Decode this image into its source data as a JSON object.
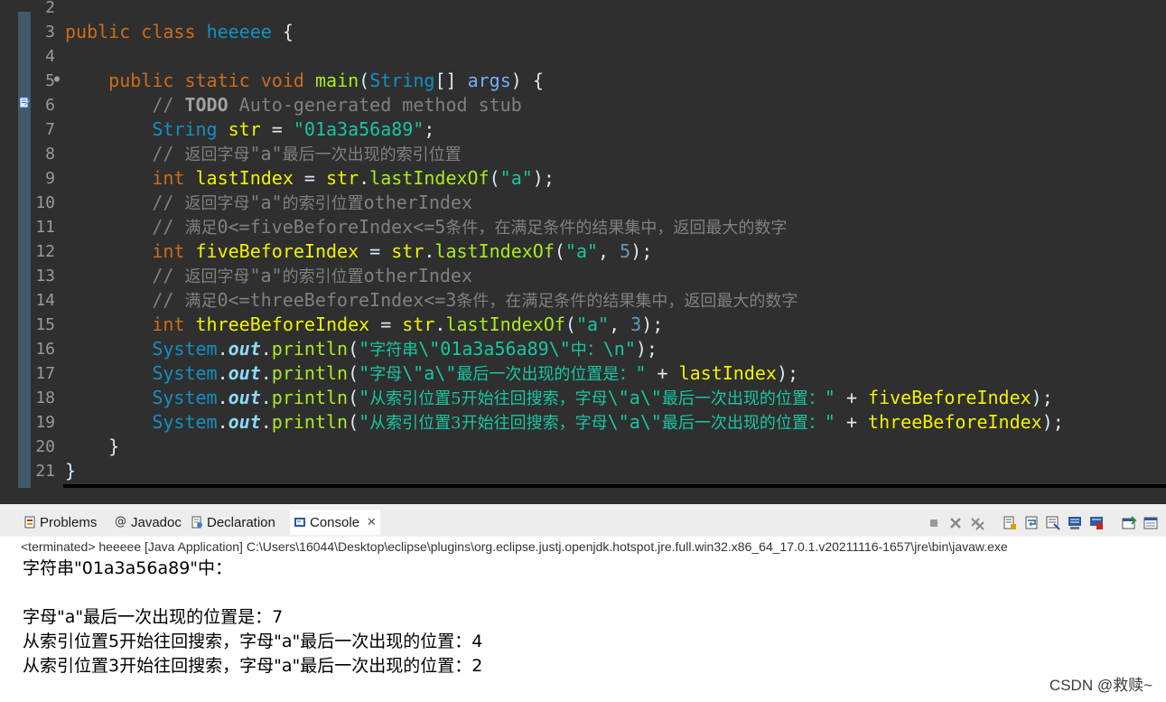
{
  "editor": {
    "lines": [
      {
        "n": "2",
        "tokens": []
      },
      {
        "n": "3",
        "tokens": [
          {
            "c": "t-kw",
            "t": "public"
          },
          {
            "c": "t-plain",
            "t": " "
          },
          {
            "c": "t-kw",
            "t": "class"
          },
          {
            "c": "t-plain",
            "t": " "
          },
          {
            "c": "t-cls",
            "t": "heeeee"
          },
          {
            "c": "t-plain",
            "t": " {"
          }
        ]
      },
      {
        "n": "4",
        "tokens": []
      },
      {
        "n": "5",
        "fold": true,
        "tokens": [
          {
            "c": "t-plain",
            "t": "    "
          },
          {
            "c": "t-kw",
            "t": "public"
          },
          {
            "c": "t-plain",
            "t": " "
          },
          {
            "c": "t-kw",
            "t": "static"
          },
          {
            "c": "t-plain",
            "t": " "
          },
          {
            "c": "t-kw",
            "t": "void"
          },
          {
            "c": "t-plain",
            "t": " "
          },
          {
            "c": "t-meth",
            "t": "main"
          },
          {
            "c": "t-plain",
            "t": "("
          },
          {
            "c": "t-cls",
            "t": "String"
          },
          {
            "c": "t-plain",
            "t": "[] "
          },
          {
            "c": "t-par",
            "t": "args"
          },
          {
            "c": "t-plain",
            "t": ") {"
          }
        ]
      },
      {
        "n": "6",
        "tokens": [
          {
            "c": "t-plain",
            "t": "        "
          },
          {
            "c": "t-cmt",
            "t": "// "
          },
          {
            "c": "t-todo",
            "t": "TODO"
          },
          {
            "c": "t-cmt",
            "t": " Auto-generated method stub"
          }
        ]
      },
      {
        "n": "7",
        "tokens": [
          {
            "c": "t-plain",
            "t": "        "
          },
          {
            "c": "t-cls",
            "t": "String"
          },
          {
            "c": "t-plain",
            "t": " "
          },
          {
            "c": "t-var",
            "t": "str"
          },
          {
            "c": "t-plain",
            "t": " = "
          },
          {
            "c": "t-str",
            "t": "\"01a3a56a89\""
          },
          {
            "c": "t-plain",
            "t": ";"
          }
        ]
      },
      {
        "n": "8",
        "tokens": [
          {
            "c": "t-plain",
            "t": "        "
          },
          {
            "c": "t-cmt",
            "t": "// "
          },
          {
            "c": "t-cmt zh",
            "t": "返回字母"
          },
          {
            "c": "t-cmt",
            "t": "\"a\""
          },
          {
            "c": "t-cmt zh",
            "t": "最后一次出现的索引位置"
          }
        ]
      },
      {
        "n": "9",
        "tokens": [
          {
            "c": "t-plain",
            "t": "        "
          },
          {
            "c": "t-kw",
            "t": "int"
          },
          {
            "c": "t-plain",
            "t": " "
          },
          {
            "c": "t-var",
            "t": "lastIndex"
          },
          {
            "c": "t-plain",
            "t": " = "
          },
          {
            "c": "t-var",
            "t": "str"
          },
          {
            "c": "t-plain",
            "t": "."
          },
          {
            "c": "t-meth",
            "t": "lastIndexOf"
          },
          {
            "c": "t-plain",
            "t": "("
          },
          {
            "c": "t-str",
            "t": "\"a\""
          },
          {
            "c": "t-plain",
            "t": ");"
          }
        ]
      },
      {
        "n": "10",
        "tokens": [
          {
            "c": "t-plain",
            "t": "        "
          },
          {
            "c": "t-cmt",
            "t": "// "
          },
          {
            "c": "t-cmt zh",
            "t": "返回字母"
          },
          {
            "c": "t-cmt",
            "t": "\"a\""
          },
          {
            "c": "t-cmt zh",
            "t": "的索引位置"
          },
          {
            "c": "t-cmt",
            "t": "otherIndex"
          }
        ]
      },
      {
        "n": "11",
        "tokens": [
          {
            "c": "t-plain",
            "t": "        "
          },
          {
            "c": "t-cmt",
            "t": "// "
          },
          {
            "c": "t-cmt zh",
            "t": "满足"
          },
          {
            "c": "t-cmt",
            "t": "0<=fiveBeforeIndex<=5"
          },
          {
            "c": "t-cmt zh",
            "t": "条件，在满足条件的结果集中，返回最大的数字"
          }
        ]
      },
      {
        "n": "12",
        "tokens": [
          {
            "c": "t-plain",
            "t": "        "
          },
          {
            "c": "t-kw",
            "t": "int"
          },
          {
            "c": "t-plain",
            "t": " "
          },
          {
            "c": "t-var",
            "t": "fiveBeforeIndex"
          },
          {
            "c": "t-plain",
            "t": " = "
          },
          {
            "c": "t-var",
            "t": "str"
          },
          {
            "c": "t-plain",
            "t": "."
          },
          {
            "c": "t-meth",
            "t": "lastIndexOf"
          },
          {
            "c": "t-plain",
            "t": "("
          },
          {
            "c": "t-str",
            "t": "\"a\""
          },
          {
            "c": "t-plain",
            "t": ", "
          },
          {
            "c": "t-num",
            "t": "5"
          },
          {
            "c": "t-plain",
            "t": ");"
          }
        ]
      },
      {
        "n": "13",
        "tokens": [
          {
            "c": "t-plain",
            "t": "        "
          },
          {
            "c": "t-cmt",
            "t": "// "
          },
          {
            "c": "t-cmt zh",
            "t": "返回字母"
          },
          {
            "c": "t-cmt",
            "t": "\"a\""
          },
          {
            "c": "t-cmt zh",
            "t": "的索引位置"
          },
          {
            "c": "t-cmt",
            "t": "otherIndex"
          }
        ]
      },
      {
        "n": "14",
        "tokens": [
          {
            "c": "t-plain",
            "t": "        "
          },
          {
            "c": "t-cmt",
            "t": "// "
          },
          {
            "c": "t-cmt zh",
            "t": "满足"
          },
          {
            "c": "t-cmt",
            "t": "0<=threeBeforeIndex<=3"
          },
          {
            "c": "t-cmt zh",
            "t": "条件，在满足条件的结果集中，返回最大的数字"
          }
        ]
      },
      {
        "n": "15",
        "tokens": [
          {
            "c": "t-plain",
            "t": "        "
          },
          {
            "c": "t-kw",
            "t": "int"
          },
          {
            "c": "t-plain",
            "t": " "
          },
          {
            "c": "t-var",
            "t": "threeBeforeIndex"
          },
          {
            "c": "t-plain",
            "t": " = "
          },
          {
            "c": "t-var",
            "t": "str"
          },
          {
            "c": "t-plain",
            "t": "."
          },
          {
            "c": "t-meth",
            "t": "lastIndexOf"
          },
          {
            "c": "t-plain",
            "t": "("
          },
          {
            "c": "t-str",
            "t": "\"a\""
          },
          {
            "c": "t-plain",
            "t": ", "
          },
          {
            "c": "t-num",
            "t": "3"
          },
          {
            "c": "t-plain",
            "t": ");"
          }
        ]
      },
      {
        "n": "16",
        "tokens": [
          {
            "c": "t-plain",
            "t": "        "
          },
          {
            "c": "t-cls",
            "t": "System"
          },
          {
            "c": "t-plain",
            "t": "."
          },
          {
            "c": "t-field",
            "t": "out"
          },
          {
            "c": "t-plain",
            "t": "."
          },
          {
            "c": "t-meth",
            "t": "println"
          },
          {
            "c": "t-plain",
            "t": "("
          },
          {
            "c": "t-str",
            "t": "\""
          },
          {
            "c": "t-str zh",
            "t": "字符串"
          },
          {
            "c": "t-str",
            "t": "\\\"01a3a56a89\\\""
          },
          {
            "c": "t-str zh",
            "t": "中："
          },
          {
            "c": "t-str",
            "t": "\\n\""
          },
          {
            "c": "t-plain",
            "t": ");"
          }
        ]
      },
      {
        "n": "17",
        "tokens": [
          {
            "c": "t-plain",
            "t": "        "
          },
          {
            "c": "t-cls",
            "t": "System"
          },
          {
            "c": "t-plain",
            "t": "."
          },
          {
            "c": "t-field",
            "t": "out"
          },
          {
            "c": "t-plain",
            "t": "."
          },
          {
            "c": "t-meth",
            "t": "println"
          },
          {
            "c": "t-plain",
            "t": "("
          },
          {
            "c": "t-str",
            "t": "\""
          },
          {
            "c": "t-str zh",
            "t": "字母"
          },
          {
            "c": "t-str",
            "t": "\\\"a\\\""
          },
          {
            "c": "t-str zh",
            "t": "最后一次出现的位置是："
          },
          {
            "c": "t-str",
            "t": "\""
          },
          {
            "c": "t-plain",
            "t": " + "
          },
          {
            "c": "t-var",
            "t": "lastIndex"
          },
          {
            "c": "t-plain",
            "t": ");"
          }
        ]
      },
      {
        "n": "18",
        "tokens": [
          {
            "c": "t-plain",
            "t": "        "
          },
          {
            "c": "t-cls",
            "t": "System"
          },
          {
            "c": "t-plain",
            "t": "."
          },
          {
            "c": "t-field",
            "t": "out"
          },
          {
            "c": "t-plain",
            "t": "."
          },
          {
            "c": "t-meth",
            "t": "println"
          },
          {
            "c": "t-plain",
            "t": "("
          },
          {
            "c": "t-str",
            "t": "\""
          },
          {
            "c": "t-str zh",
            "t": "从索引位置5开始往回搜索，字母"
          },
          {
            "c": "t-str",
            "t": "\\\"a\\\""
          },
          {
            "c": "t-str zh",
            "t": "最后一次出现的位置："
          },
          {
            "c": "t-str",
            "t": "\""
          },
          {
            "c": "t-plain",
            "t": " + "
          },
          {
            "c": "t-var",
            "t": "fiveBeforeIndex"
          },
          {
            "c": "t-plain",
            "t": ");"
          }
        ]
      },
      {
        "n": "19",
        "tokens": [
          {
            "c": "t-plain",
            "t": "        "
          },
          {
            "c": "t-cls",
            "t": "System"
          },
          {
            "c": "t-plain",
            "t": "."
          },
          {
            "c": "t-field",
            "t": "out"
          },
          {
            "c": "t-plain",
            "t": "."
          },
          {
            "c": "t-meth",
            "t": "println"
          },
          {
            "c": "t-plain",
            "t": "("
          },
          {
            "c": "t-str",
            "t": "\""
          },
          {
            "c": "t-str zh",
            "t": "从索引位置3开始往回搜索，字母"
          },
          {
            "c": "t-str",
            "t": "\\\"a\\\""
          },
          {
            "c": "t-str zh",
            "t": "最后一次出现的位置："
          },
          {
            "c": "t-str",
            "t": "\""
          },
          {
            "c": "t-plain",
            "t": " + "
          },
          {
            "c": "t-var",
            "t": "threeBeforeIndex"
          },
          {
            "c": "t-plain",
            "t": ");"
          }
        ]
      },
      {
        "n": "20",
        "tokens": [
          {
            "c": "t-plain",
            "t": "    }"
          }
        ]
      },
      {
        "n": "21",
        "tokens": [
          {
            "c": "t-plain",
            "t": "}"
          }
        ]
      }
    ],
    "hscroll_left": "<"
  },
  "console": {
    "tabs": [
      {
        "label": "Problems",
        "icon": "problems-icon",
        "name": "tab-problems"
      },
      {
        "label": "Javadoc",
        "icon": "javadoc-icon",
        "name": "tab-javadoc"
      },
      {
        "label": "Declaration",
        "icon": "declaration-icon",
        "name": "tab-declaration"
      },
      {
        "label": "Console",
        "icon": "console-icon",
        "name": "tab-console",
        "active": true,
        "close": "✕"
      }
    ],
    "toolbar_icons": [
      "terminate-icon",
      "remove-launch-icon",
      "remove-all-terminated-icon",
      "scroll-lock-icon",
      "word-wrap-icon",
      "show-on-stdout-icon",
      "show-on-stderr-icon",
      "pin-console-icon",
      "display-console-icon"
    ],
    "status": "<terminated> heeeee [Java Application] C:\\Users\\16044\\Desktop\\eclipse\\plugins\\org.eclipse.justj.openjdk.hotspot.jre.full.win32.x86_64_17.0.1.v20211116-1657\\jre\\bin\\javaw.exe",
    "output": [
      "字符串\"01a3a56a89\"中：",
      "",
      "字母\"a\"最后一次出现的位置是：7",
      "从索引位置5开始往回搜索，字母\"a\"最后一次出现的位置：4",
      "从索引位置3开始往回搜索，字母\"a\"最后一次出现的位置：2"
    ]
  },
  "watermark": "CSDN @救赎~",
  "colors": {
    "editor_bg": "#2f2f2f",
    "keyword": "#cc6c1d",
    "class": "#1290c3",
    "method": "#a7ec21",
    "string": "#17c6a3",
    "comment": "#808080",
    "variable": "#f2f200",
    "console_bg": "#ffffff"
  }
}
